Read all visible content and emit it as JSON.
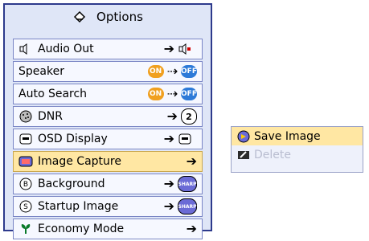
{
  "menu": {
    "title": "Options",
    "items": [
      {
        "label": "Audio Out"
      },
      {
        "label": "Speaker",
        "states": [
          "ON",
          "OFF"
        ]
      },
      {
        "label": "Auto Search",
        "states": [
          "ON",
          "OFF"
        ]
      },
      {
        "label": "DNR",
        "value": "2"
      },
      {
        "label": "OSD Display"
      },
      {
        "label": "Image Capture"
      },
      {
        "label": "Background",
        "value": "SHARP"
      },
      {
        "label": "Startup Image",
        "value": "SHARP"
      },
      {
        "label": "Economy Mode"
      }
    ]
  },
  "submenu": {
    "items": [
      {
        "label": "Save Image"
      },
      {
        "label": "Delete"
      }
    ]
  },
  "colors": {
    "frame": "#2d3a8c",
    "panel": "#dfe6f7",
    "highlight": "#ffe7a3",
    "on": "#f0a020",
    "off": "#2d7ad8"
  },
  "icons": [
    "options-icon",
    "speaker-icon",
    "dnr-icon",
    "osd-icon",
    "image-capture-icon",
    "background-icon",
    "startup-icon",
    "economy-icon",
    "save-image-icon",
    "delete-icon"
  ]
}
